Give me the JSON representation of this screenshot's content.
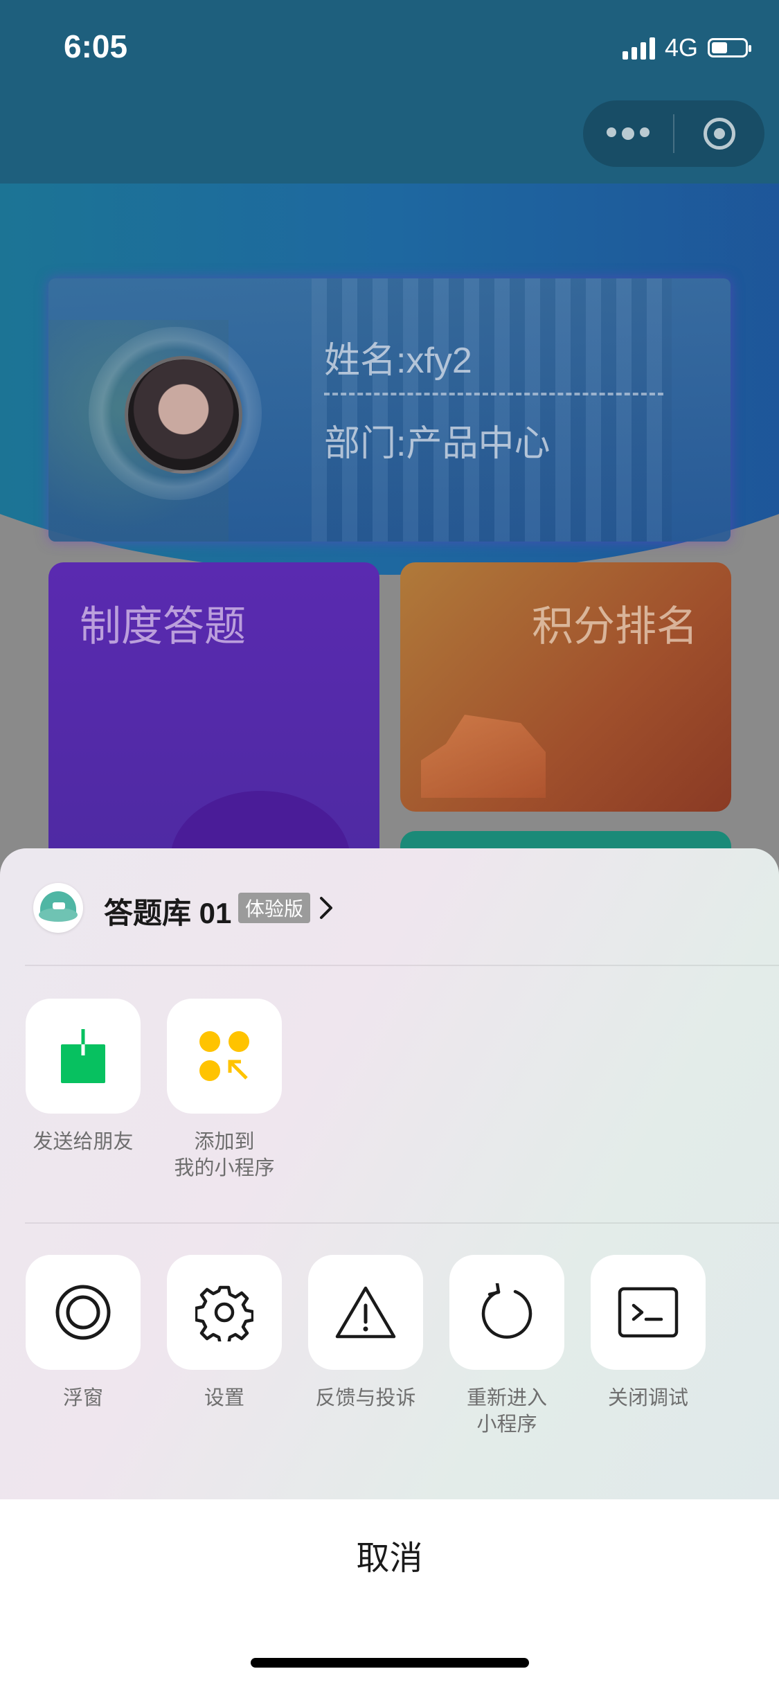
{
  "status": {
    "time": "6:05",
    "network": "4G"
  },
  "background_app": {
    "profile": {
      "name": "姓名:xfy2",
      "department": "部门:产品中心"
    },
    "cards": {
      "quiz": "制度答题",
      "rank": "积分排名"
    }
  },
  "sheet": {
    "app_name": "答题库 01",
    "badge": "体验版",
    "row1": [
      {
        "label": "发送给朋友",
        "icon": "share-icon"
      },
      {
        "label": "添加到\n我的小程序",
        "icon": "add-miniprogram-icon"
      }
    ],
    "row2": [
      {
        "label": "浮窗",
        "icon": "float-window-icon"
      },
      {
        "label": "设置",
        "icon": "gear-icon"
      },
      {
        "label": "反馈与投诉",
        "icon": "warning-icon"
      },
      {
        "label": "重新进入\n小程序",
        "icon": "reload-icon"
      },
      {
        "label": "关闭调试",
        "icon": "terminal-icon"
      }
    ],
    "cancel": "取消"
  },
  "colors": {
    "share_green": "#07C160",
    "dots_yellow": "#FFC300",
    "header_teal": "#1E5F7D"
  }
}
